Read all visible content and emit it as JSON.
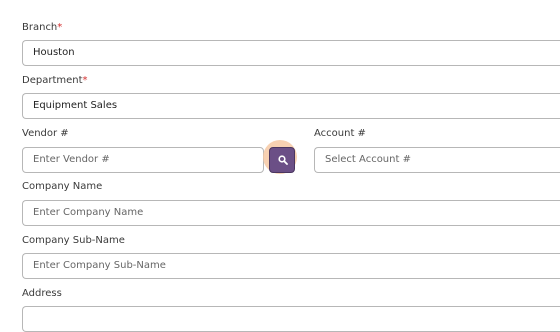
{
  "form": {
    "branch": {
      "label": "Branch",
      "required_mark": "*",
      "value": "Houston",
      "clear_icon": "×"
    },
    "department": {
      "label": "Department",
      "required_mark": "*",
      "value": "Equipment Sales",
      "clear_icon": "×"
    },
    "vendor": {
      "label": "Vendor #",
      "placeholder": "Enter Vendor #"
    },
    "account": {
      "label": "Account #",
      "placeholder": "Select Account #"
    },
    "company_name": {
      "label": "Company Name",
      "placeholder": "Enter Company Name"
    },
    "company_sub_name": {
      "label": "Company Sub-Name",
      "placeholder": "Enter Company Sub-Name"
    },
    "address": {
      "label": "Address"
    }
  },
  "icons": {
    "vendor_search": "search-icon"
  },
  "colors": {
    "search_button": "#6b4f86",
    "search_halo": "#f6c9a5",
    "required": "#d32f2f"
  }
}
